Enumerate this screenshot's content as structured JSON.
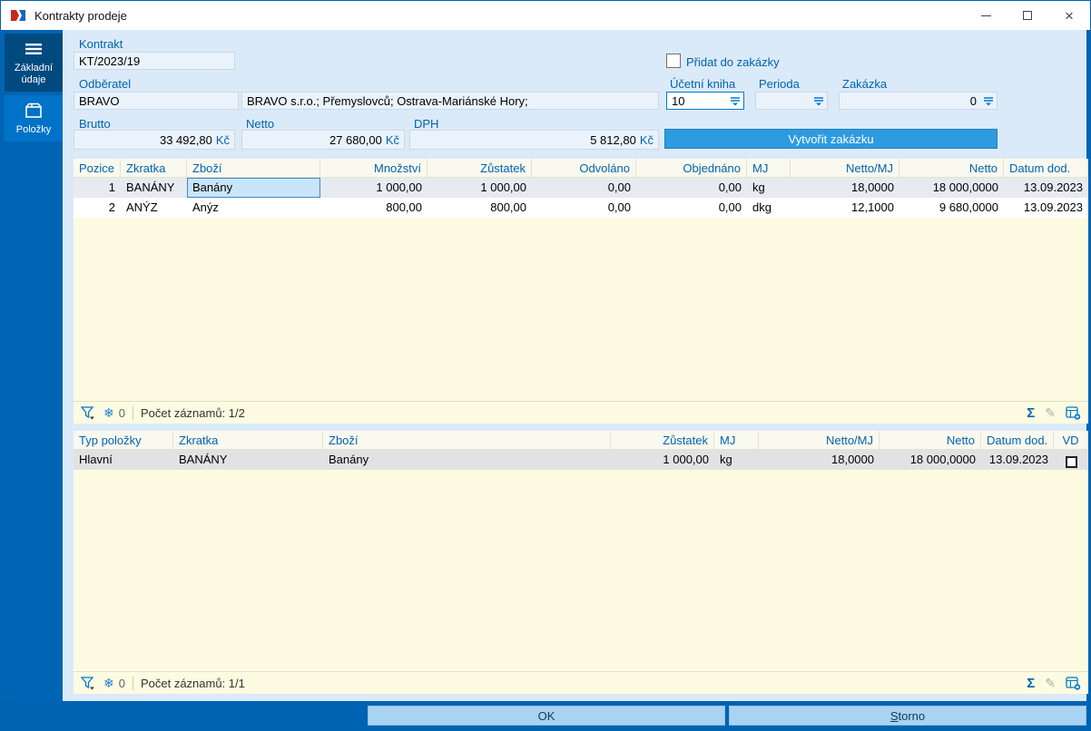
{
  "window": {
    "title": "Kontrakty prodeje"
  },
  "sidebar": {
    "items": [
      {
        "label": "Základní údaje",
        "icon": "menu-icon"
      },
      {
        "label": "Položky",
        "icon": "package-icon"
      }
    ]
  },
  "form": {
    "kontrakt_label": "Kontrakt",
    "kontrakt_value": "KT/2023/19",
    "odberatel_label": "Odběratel",
    "odberatel_code": "BRAVO",
    "odberatel_name": "BRAVO s.r.o.; Přemyslovců; Ostrava-Mariánské Hory;",
    "pridat_checkbox_label": "Přidat do zakázky",
    "ucetni_kniha_label": "Účetní kniha",
    "ucetni_kniha_value": "10",
    "perioda_label": "Perioda",
    "perioda_value": "",
    "zakazka_label": "Zakázka",
    "zakazka_value": "0",
    "brutto_label": "Brutto",
    "brutto_value": "33 492,80",
    "netto_label": "Netto",
    "netto_value": "27 680,00",
    "dph_label": "DPH",
    "dph_value": "5 812,80",
    "currency": "Kč",
    "vytvorit_button": "Vytvořit zakázku"
  },
  "table1": {
    "headers": [
      "Pozice",
      "Zkratka",
      "Zboží",
      "Množství",
      "Zůstatek",
      "Odvoláno",
      "Objednáno",
      "MJ",
      "Netto/MJ",
      "Netto",
      "Datum dod."
    ],
    "rows": [
      [
        "1",
        "BANÁNY",
        "Banány",
        "1 000,00",
        "1 000,00",
        "0,00",
        "0,00",
        "kg",
        "18,0000",
        "18 000,0000",
        "13.09.2023"
      ],
      [
        "2",
        "ANÝZ",
        "Anýz",
        "800,00",
        "800,00",
        "0,00",
        "0,00",
        "dkg",
        "12,1000",
        "9 680,0000",
        "13.09.2023"
      ]
    ],
    "status": {
      "count": "0",
      "records": "Počet záznamů: 1/2"
    }
  },
  "table2": {
    "headers": [
      "Typ položky",
      "Zkratka",
      "Zboží",
      "Zůstatek",
      "MJ",
      "Netto/MJ",
      "Netto",
      "Datum dod.",
      "VD"
    ],
    "rows": [
      [
        "Hlavní",
        "BANÁNY",
        "Banány",
        "1 000,00",
        "kg",
        "18,0000",
        "18 000,0000",
        "13.09.2023"
      ]
    ],
    "status": {
      "count": "0",
      "records": "Počet záznamů: 1/1"
    }
  },
  "footer": {
    "ok_label": "OK",
    "storno_label": "Storno"
  },
  "icons": {
    "snowflake": "❄",
    "sum": "Σ",
    "pencil": "✎",
    "close": "×"
  },
  "colors": {
    "accent": "#0063B1",
    "button_blue": "#2E9BDF",
    "grid_bg": "#FDFBE1",
    "content_bg": "#DBEAF8"
  }
}
